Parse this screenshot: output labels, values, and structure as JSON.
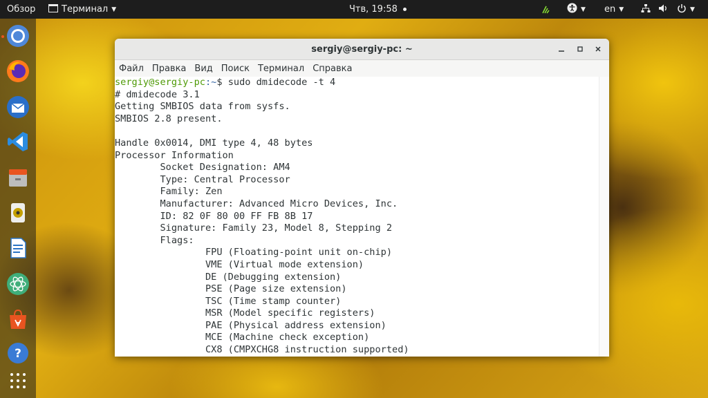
{
  "topbar": {
    "overview": "Обзор",
    "app_menu": "Терминал",
    "clock": "Чтв, 19:58",
    "language": "en"
  },
  "window": {
    "title": "sergiy@sergiy-pc: ~",
    "menu": [
      "Файл",
      "Правка",
      "Вид",
      "Поиск",
      "Терминал",
      "Справка"
    ]
  },
  "terminal": {
    "prompt_user": "sergiy@sergiy-pc",
    "prompt_path": ":~",
    "command": "$ sudo dmidecode -t 4",
    "lines": [
      "# dmidecode 3.1",
      "Getting SMBIOS data from sysfs.",
      "SMBIOS 2.8 present.",
      "",
      "Handle 0x0014, DMI type 4, 48 bytes",
      "Processor Information",
      "        Socket Designation: AM4",
      "        Type: Central Processor",
      "        Family: Zen",
      "        Manufacturer: Advanced Micro Devices, Inc.",
      "        ID: 82 0F 80 00 FF FB 8B 17",
      "        Signature: Family 23, Model 8, Stepping 2",
      "        Flags:",
      "                FPU (Floating-point unit on-chip)",
      "                VME (Virtual mode extension)",
      "                DE (Debugging extension)",
      "                PSE (Page size extension)",
      "                TSC (Time stamp counter)",
      "                MSR (Model specific registers)",
      "                PAE (Physical address extension)",
      "                MCE (Machine check exception)",
      "                CX8 (CMPXCHG8 instruction supported)"
    ]
  },
  "dock": [
    "chromium-icon",
    "firefox-icon",
    "thunderbird-icon",
    "vscode-icon",
    "files-icon",
    "rhythmbox-icon",
    "writer-icon",
    "atom-icon",
    "software-center-icon",
    "help-icon",
    "app-grid-icon"
  ],
  "colors": {
    "prompt_user": "#4e9a06",
    "prompt_path": "#3465a4",
    "accent": "#e95420"
  }
}
